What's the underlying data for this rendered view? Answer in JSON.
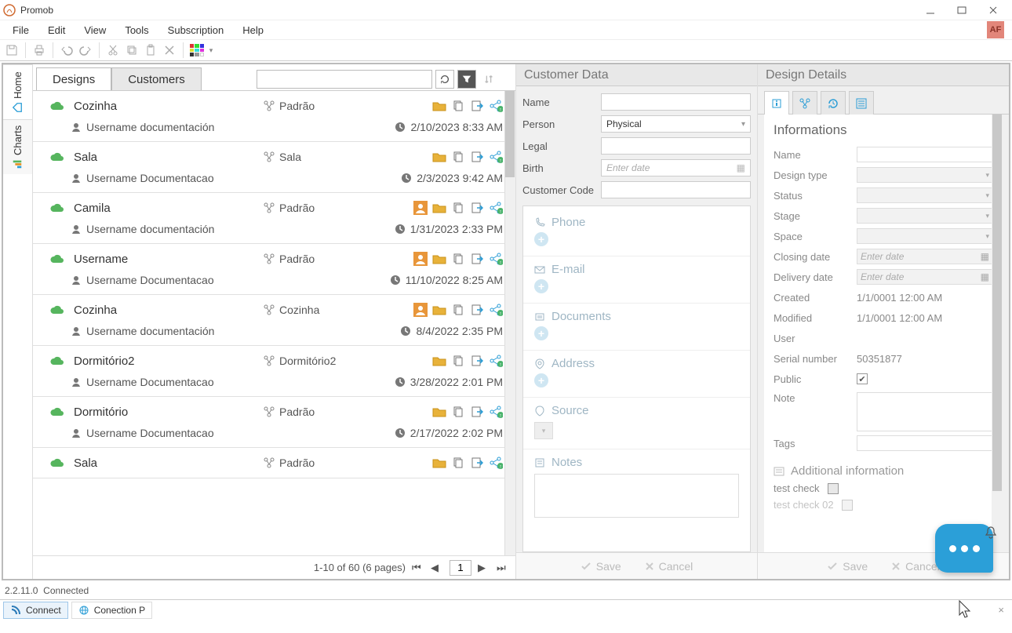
{
  "app": {
    "title": "Promob"
  },
  "menus": [
    "File",
    "Edit",
    "View",
    "Tools",
    "Subscription",
    "Help"
  ],
  "avatar": "AF",
  "side_tabs": {
    "home": "Home",
    "charts": "Charts"
  },
  "tabs": {
    "designs": "Designs",
    "customers": "Customers"
  },
  "designs": [
    {
      "name": "Cozinha",
      "type": "Padrão",
      "user": "Username documentación",
      "date": "2/10/2023 8:33 AM",
      "badge": false
    },
    {
      "name": "Sala",
      "type": "Sala",
      "user": "Username Documentacao",
      "date": "2/3/2023 9:42 AM",
      "badge": false
    },
    {
      "name": "Camila",
      "type": "Padrão",
      "user": "Username documentación",
      "date": "1/31/2023 2:33 PM",
      "badge": true
    },
    {
      "name": "Username",
      "type": "Padrão",
      "user": "Username Documentacao",
      "date": "11/10/2022 8:25 AM",
      "badge": true
    },
    {
      "name": "Cozinha",
      "type": "Cozinha",
      "user": "Username documentación",
      "date": "8/4/2022 2:35 PM",
      "badge": true
    },
    {
      "name": "Dormitório2",
      "type": "Dormitório2",
      "user": "Username Documentacao",
      "date": "3/28/2022 2:01 PM",
      "badge": false
    },
    {
      "name": "Dormitório",
      "type": "Padrão",
      "user": "Username Documentacao",
      "date": "2/17/2022 2:02 PM",
      "badge": false
    },
    {
      "name": "Sala",
      "type": "Padrão",
      "user": "",
      "date": "",
      "badge": false
    }
  ],
  "pager": {
    "summary": "1-10 of 60 (6 pages)",
    "page": "1"
  },
  "customer_panel": {
    "title": "Customer Data",
    "labels": {
      "name": "Name",
      "person": "Person",
      "legal": "Legal",
      "birth": "Birth",
      "code": "Customer Code"
    },
    "person_value": "Physical",
    "birth_placeholder": "Enter date",
    "sections": {
      "phone": "Phone",
      "email": "E-mail",
      "documents": "Documents",
      "address": "Address",
      "source": "Source",
      "notes": "Notes"
    },
    "footer": {
      "save": "Save",
      "cancel": "Cancel"
    }
  },
  "details_panel": {
    "title": "Design Details",
    "section_title": "Informations",
    "labels": {
      "name": "Name",
      "design_type": "Design type",
      "status": "Status",
      "stage": "Stage",
      "space": "Space",
      "closing": "Closing date",
      "delivery": "Delivery date",
      "created": "Created",
      "modified": "Modified",
      "user": "User",
      "serial": "Serial number",
      "public": "Public",
      "note": "Note",
      "tags": "Tags"
    },
    "date_placeholder": "Enter date",
    "created_value": "1/1/0001 12:00 AM",
    "modified_value": "1/1/0001 12:00 AM",
    "serial_value": "50351877",
    "additional_title": "Additional information",
    "checks": [
      "test check",
      "test check 02"
    ],
    "footer": {
      "save": "Save",
      "cancel": "Cancel"
    }
  },
  "status": {
    "version": "2.2.11.0",
    "state": "Connected"
  },
  "bottom": {
    "connect": "Connect",
    "conection": "Conection P"
  }
}
